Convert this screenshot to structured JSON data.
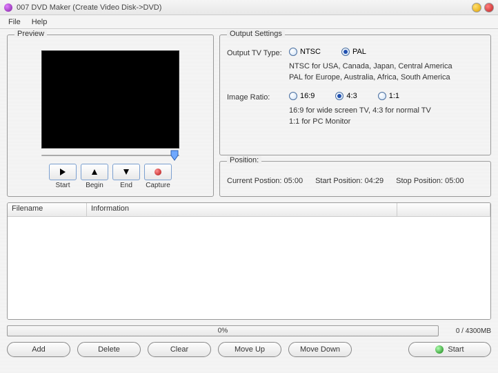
{
  "title": "007 DVD Maker (Create Video Disk->DVD)",
  "menu": {
    "file": "File",
    "help": "Help"
  },
  "preview": {
    "legend": "Preview",
    "btns": {
      "start": "Start",
      "begin": "Begin",
      "end": "End",
      "capture": "Capture"
    }
  },
  "settings": {
    "legend": "Output Settings",
    "tv_label": "Output TV Type:",
    "tv_opts": {
      "ntsc": "NTSC",
      "pal": "PAL"
    },
    "tv_selected": "pal",
    "tv_hint1": "NTSC for USA, Canada, Japan, Central  America",
    "tv_hint2": "PAL for Europe, Australia, Africa, South America",
    "ratio_label": "Image Ratio:",
    "ratio_opts": {
      "r169": "16:9",
      "r43": "4:3",
      "r11": "1:1"
    },
    "ratio_selected": "r43",
    "ratio_hint1": "16:9 for wide screen TV,  4:3 for normal TV",
    "ratio_hint2": "1:1 for PC Monitor"
  },
  "position": {
    "legend": "Position:",
    "current_lbl": "Current Postion:",
    "current_val": "05:00",
    "start_lbl": "Start Position:",
    "start_val": "04:29",
    "stop_lbl": "Stop Position:",
    "stop_val": "05:00"
  },
  "file_cols": {
    "filename": "Filename",
    "info": "Information"
  },
  "progress": {
    "pct": "0%",
    "capacity": "0 / 4300MB"
  },
  "actions": {
    "add": "Add",
    "delete": "Delete",
    "clear": "Clear",
    "moveup": "Move Up",
    "movedown": "Move Down",
    "start": "Start"
  }
}
